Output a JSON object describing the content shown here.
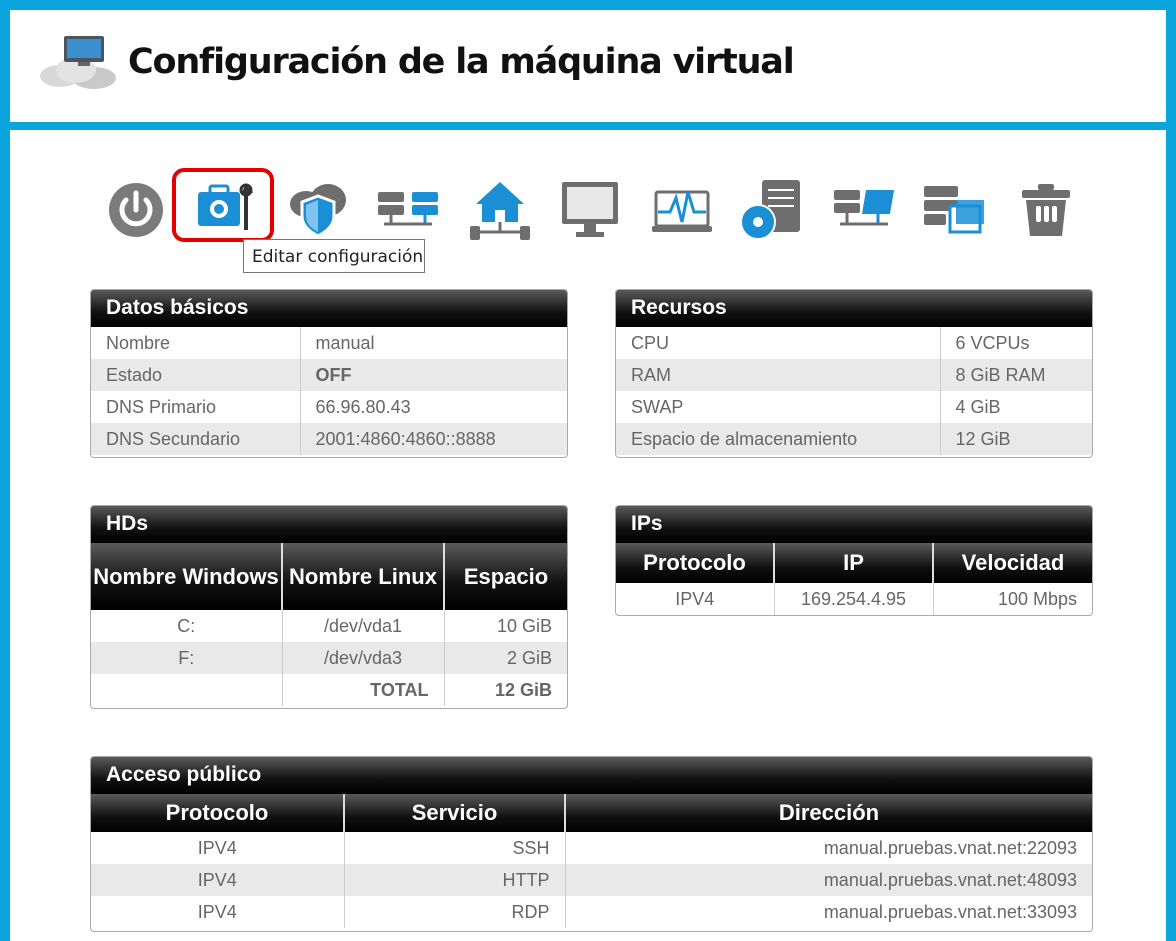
{
  "header": {
    "title": "Configuración de la máquina virtual"
  },
  "toolbar": {
    "icons": [
      "power-icon",
      "edit-config-icon",
      "cloud-shield-icon",
      "servers-icon",
      "home-network-icon",
      "monitor-icon",
      "monitoring-icon",
      "disk-server-icon",
      "server-network-icon",
      "server-images-icon",
      "trash-icon"
    ],
    "tooltip": "Editar configuración"
  },
  "datos_basicos": {
    "title": "Datos básicos",
    "rows": [
      {
        "label": "Nombre",
        "value": "manual"
      },
      {
        "label": "Estado",
        "value": "OFF"
      },
      {
        "label": "DNS Primario",
        "value": "66.96.80.43"
      },
      {
        "label": "DNS Secundario",
        "value": "2001:4860:4860::8888"
      }
    ]
  },
  "recursos": {
    "title": "Recursos",
    "rows": [
      {
        "label": "CPU",
        "value": "6 VCPUs"
      },
      {
        "label": "RAM",
        "value": "8 GiB RAM"
      },
      {
        "label": "SWAP",
        "value": "4 GiB"
      },
      {
        "label": "Espacio de almacenamiento",
        "value": "12 GiB"
      }
    ]
  },
  "hds": {
    "title": "HDs",
    "columns": [
      "Nombre Windows",
      "Nombre Linux",
      "Espacio"
    ],
    "rows": [
      {
        "windows": "C:",
        "linux": "/dev/vda1",
        "space": "10 GiB"
      },
      {
        "windows": "F:",
        "linux": "/dev/vda3",
        "space": "2 GiB"
      }
    ],
    "total_label": "TOTAL",
    "total_value": "12 GiB"
  },
  "ips": {
    "title": "IPs",
    "columns": [
      "Protocolo",
      "IP",
      "Velocidad"
    ],
    "rows": [
      {
        "protocol": "IPV4",
        "ip": "169.254.4.95",
        "speed": "100 Mbps"
      }
    ]
  },
  "acceso": {
    "title": "Acceso público",
    "columns": [
      "Protocolo",
      "Servicio",
      "Dirección"
    ],
    "rows": [
      {
        "protocol": "IPV4",
        "service": "SSH",
        "address": "manual.pruebas.vnat.net:22093"
      },
      {
        "protocol": "IPV4",
        "service": "HTTP",
        "address": "manual.pruebas.vnat.net:48093"
      },
      {
        "protocol": "IPV4",
        "service": "RDP",
        "address": "manual.pruebas.vnat.net:33093"
      }
    ]
  }
}
